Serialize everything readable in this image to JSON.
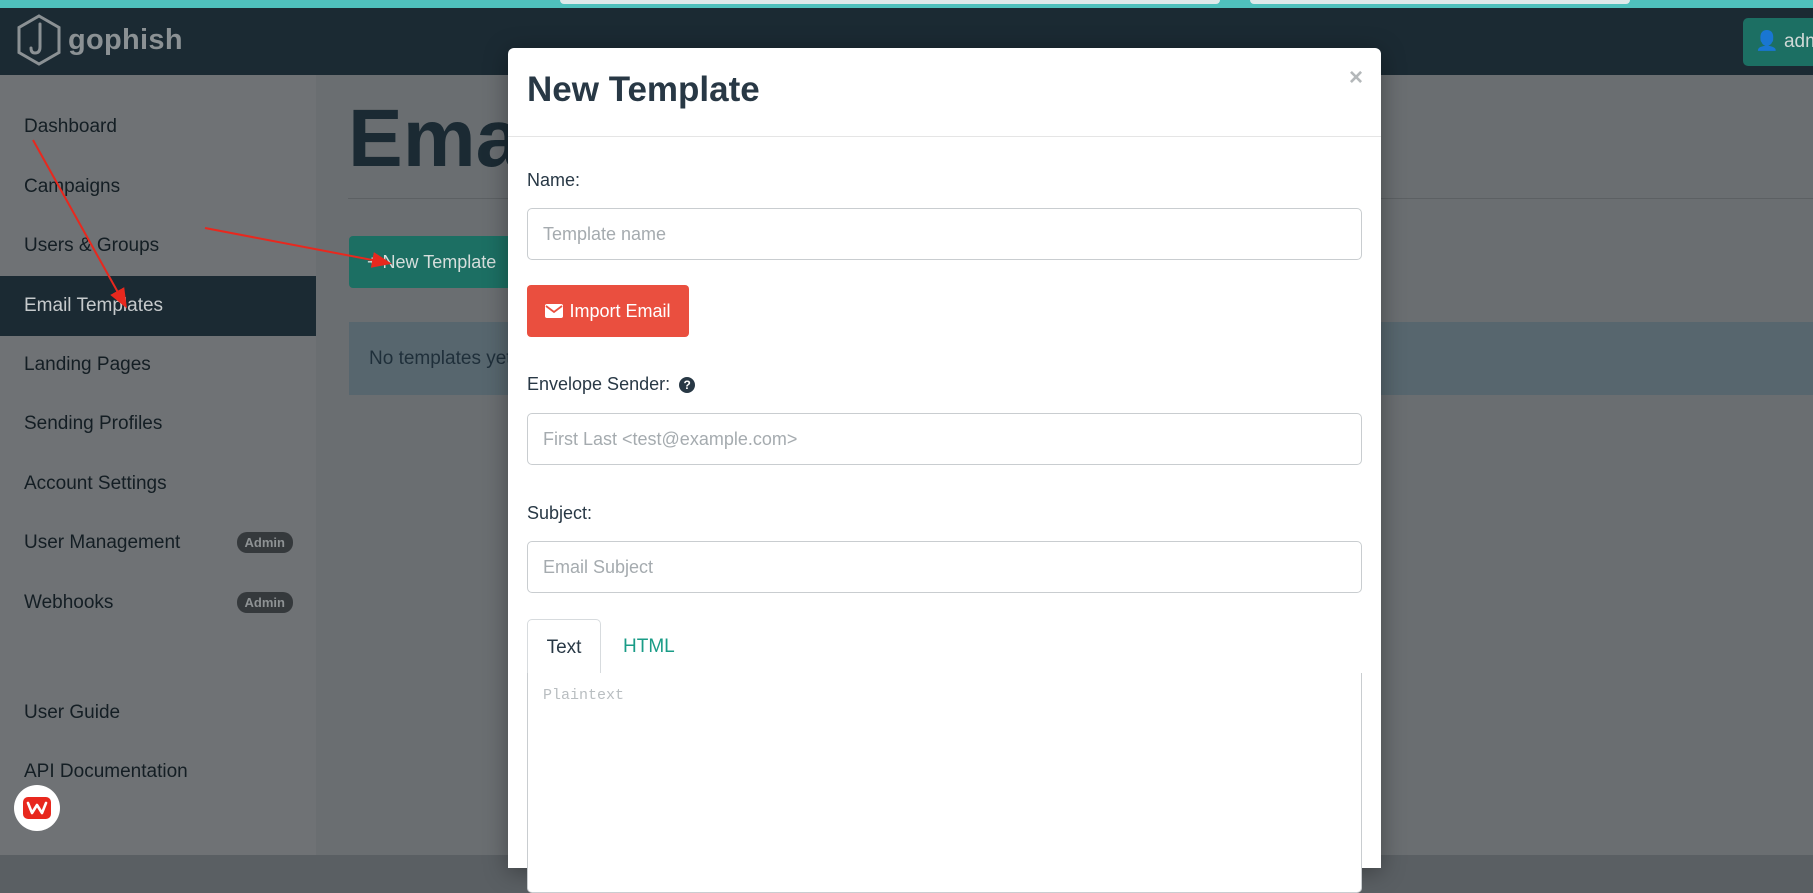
{
  "brand": {
    "name": "gophish"
  },
  "navbar": {
    "user_label": "adm"
  },
  "sidebar": {
    "items": [
      {
        "label": "Dashboard",
        "badge": ""
      },
      {
        "label": "Campaigns",
        "badge": ""
      },
      {
        "label": "Users & Groups",
        "badge": ""
      },
      {
        "label": "Email Templates",
        "badge": ""
      },
      {
        "label": "Landing Pages",
        "badge": ""
      },
      {
        "label": "Sending Profiles",
        "badge": ""
      },
      {
        "label": "Account Settings",
        "badge": ""
      },
      {
        "label": "User Management",
        "badge": "Admin"
      },
      {
        "label": "Webhooks",
        "badge": "Admin"
      }
    ],
    "footer_items": [
      {
        "label": "User Guide"
      },
      {
        "label": "API Documentation"
      }
    ]
  },
  "main": {
    "title": "Emai",
    "new_template_button": "New Template",
    "alert_text": "No templates yet"
  },
  "modal": {
    "title": "New Template",
    "close": "×",
    "name_label": "Name:",
    "name_placeholder": "Template name",
    "import_label": "Import Email",
    "envelope_label": "Envelope Sender:",
    "envelope_placeholder": "First Last <test@example.com>",
    "subject_label": "Subject:",
    "subject_placeholder": "Email Subject",
    "tabs": [
      {
        "label": "Text"
      },
      {
        "label": "HTML"
      }
    ],
    "text_placeholder": "Plaintext"
  },
  "colors": {
    "navbar": "#1b2a33",
    "accent_green": "#1c6f63",
    "import_red": "#ea4f3f",
    "tab_link": "#1a9c87",
    "annotation_arrow": "#e8281e"
  },
  "icons": [
    "gophish-logo-icon",
    "user-icon",
    "plus-icon",
    "envelope-icon",
    "question-circle-icon",
    "wps-office-icon"
  ]
}
